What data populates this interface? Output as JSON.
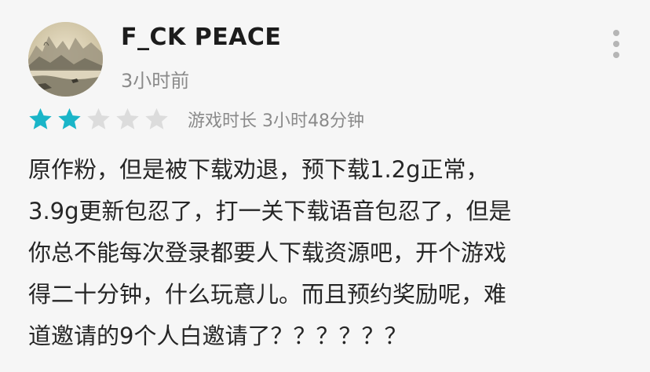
{
  "review": {
    "username": "F_CK PEACE",
    "timestamp": "3小时前",
    "rating": {
      "value": 2,
      "max": 5,
      "filled_color": "#1ab5c8",
      "empty_color": "#dcdcdc"
    },
    "playtime": "游戏时长 3小时48分钟",
    "body_lines": [
      "原作粉，但是被下载劝退，预下载1.2g正常，",
      "3.9g更新包忍了，打一关下载语音包忍了，但是",
      "你总不能每次登录都要人下载资源吧，开个游戏",
      "得二十分钟，什么玩意儿。而且预约奖励呢，难",
      "道邀请的9个人白邀请了？？？？？？"
    ]
  },
  "icons": {
    "avatar": "landscape-painting-avatar",
    "menu": "more-vertical-icon",
    "star": "star-icon"
  }
}
